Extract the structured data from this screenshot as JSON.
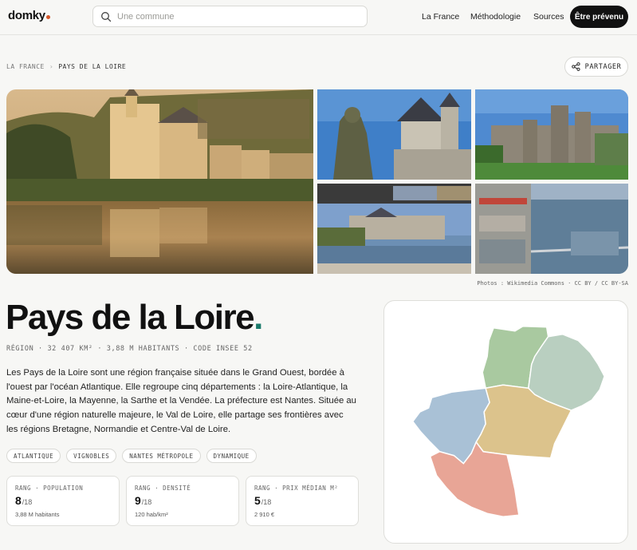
{
  "header": {
    "logo": "domky",
    "search_placeholder": "Une commune",
    "nav": [
      "La France",
      "Méthodologie",
      "Sources"
    ],
    "cta": "Être prévenu"
  },
  "breadcrumb": [
    "LA FRANCE",
    "PAYS DE LA LOIRE"
  ],
  "share_label": "PARTAGER",
  "photo_credit": "Photos : Wikimedia Commons · CC BY / CC BY-SA",
  "region": {
    "title": "Pays de la Loire",
    "title_dot": ".",
    "meta": "RÉGION · 32 407 KM² · 3,88 M HABITANTS · CODE INSEE 52",
    "description": "Les Pays de la Loire sont une région française située dans le Grand Ouest, bordée à l'ouest par l'océan Atlantique. Elle regroupe cinq départements : la Loire-Atlantique, la Maine-et-Loire, la Mayenne, la Sarthe et la Vendée. La préfecture est Nantes. Située au cœur d'une région naturelle majeure, le Val de Loire, elle partage ses frontières avec les régions Bretagne, Normandie et Centre-Val de Loire."
  },
  "tags": [
    "ATLANTIQUE",
    "VIGNOBLES",
    "NANTES MÉTROPOLE",
    "DYNAMIQUE"
  ],
  "stats": [
    {
      "label": "RANG · POPULATION",
      "rank": "8",
      "of": "/18",
      "sub": "3,88 M habitants"
    },
    {
      "label": "RANG · DENSITÉ",
      "rank": "9",
      "of": "/18",
      "sub": "120 hab/km²"
    },
    {
      "label": "RANG · PRIX MÉDIAN M²",
      "rank": "5",
      "of": "/18",
      "sub": "2 910 €"
    }
  ],
  "map_colors": {
    "mayenne": "#a9c9a0",
    "sarthe": "#b9cfc0",
    "loire_atlantique": "#a9c1d6",
    "maine_et_loire": "#dcc38c",
    "vendee": "#e8a596"
  },
  "accent_color": "#1a7a6a",
  "logo_dot_color": "#d4572a"
}
